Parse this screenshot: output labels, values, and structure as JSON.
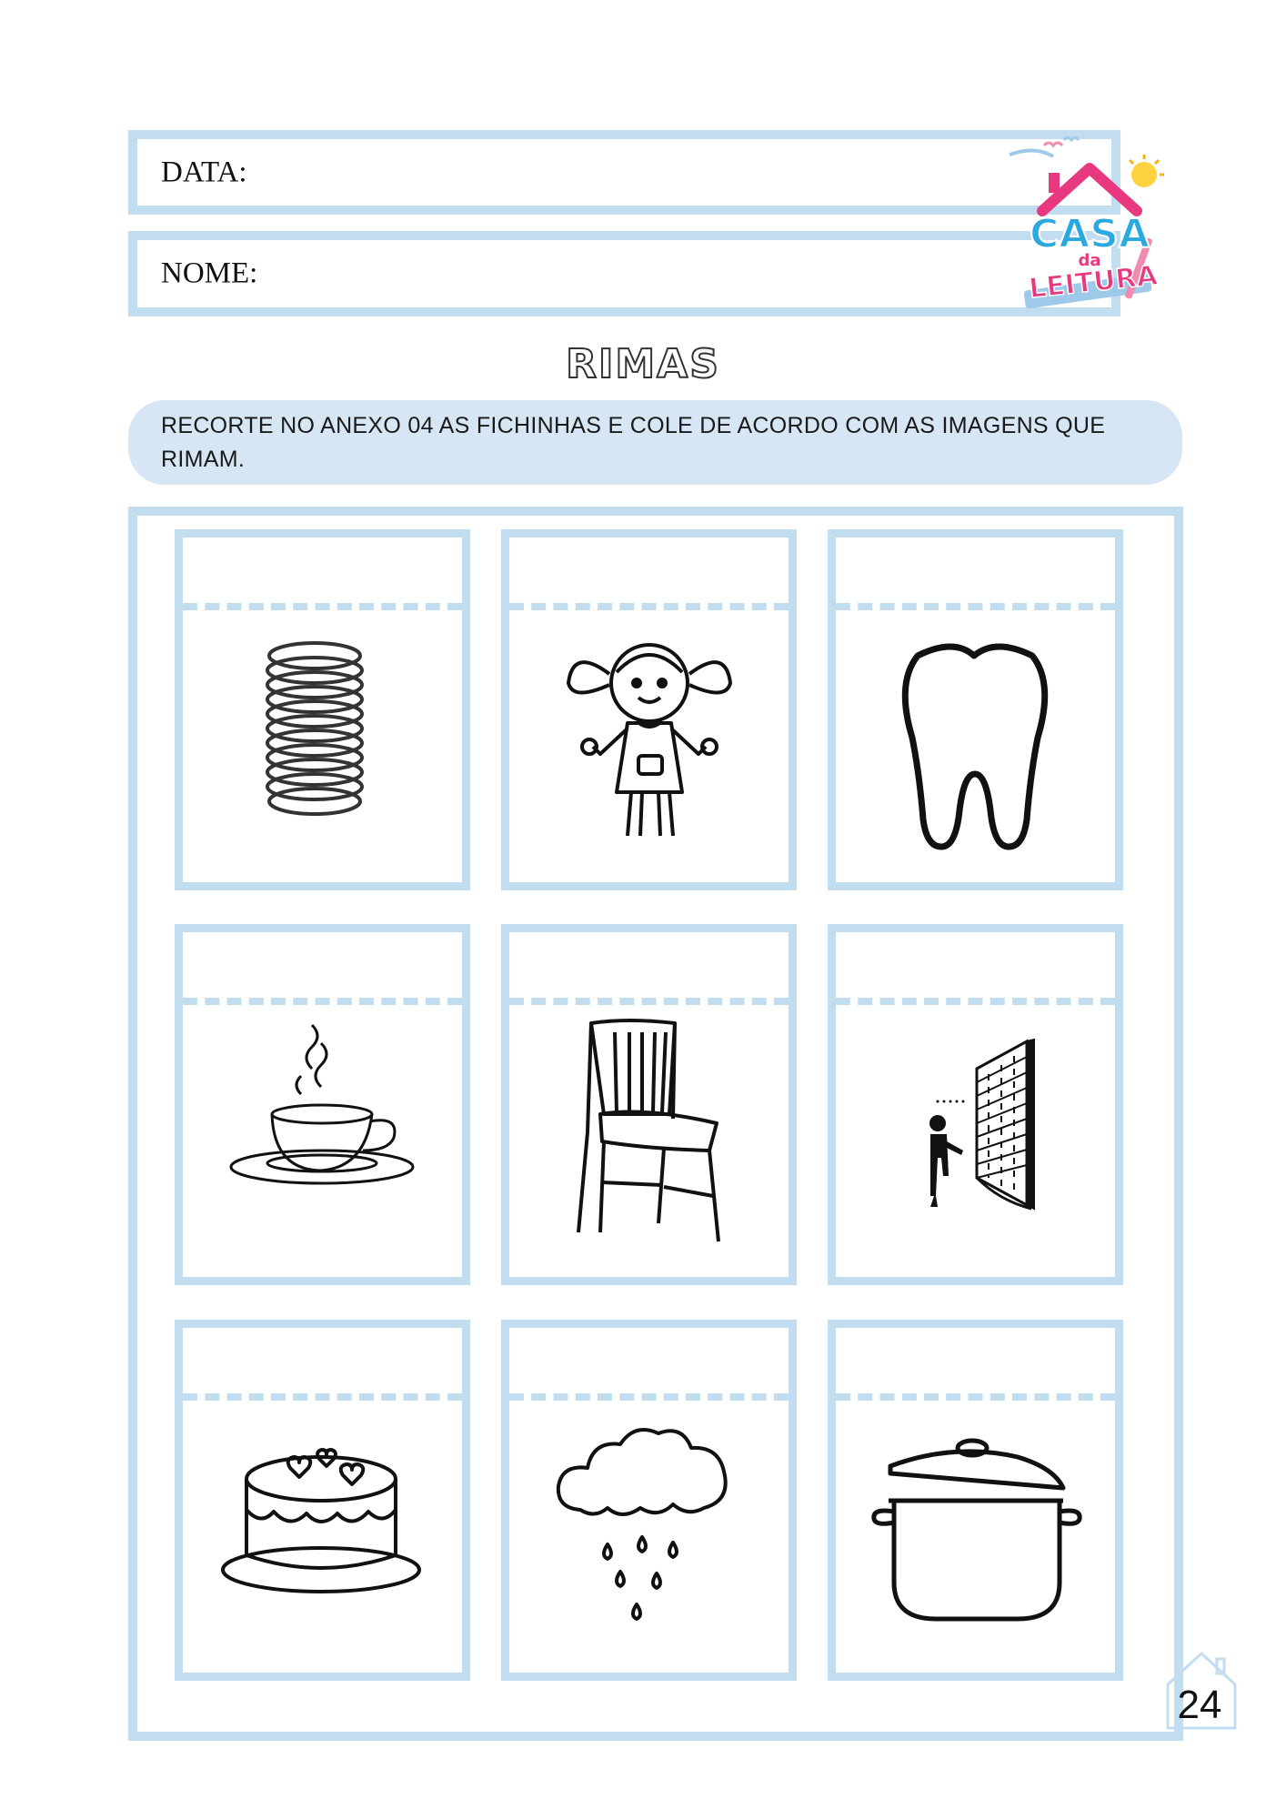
{
  "header": {
    "date_label": "DATA:",
    "name_label": "NOME:"
  },
  "logo": {
    "line1": "CASA",
    "line2": "da",
    "line3": "LEITURA"
  },
  "title": "RIMAS",
  "instruction": "RECORTE NO ANEXO 04 AS FICHINHAS E COLE DE ACORDO COM AS IMAGENS QUE RIMAM.",
  "cards": [
    {
      "icon": "spring-icon"
    },
    {
      "icon": "doll-icon"
    },
    {
      "icon": "tooth-icon"
    },
    {
      "icon": "teacup-icon"
    },
    {
      "icon": "chair-icon"
    },
    {
      "icon": "wall-icon"
    },
    {
      "icon": "cake-icon"
    },
    {
      "icon": "raincloud-icon"
    },
    {
      "icon": "pot-icon"
    }
  ],
  "page_number": "24",
  "colors": {
    "frame_blue": "#c2dcf0",
    "instruction_bg": "#d6e6f4",
    "logo_pink": "#e8387f",
    "logo_blue": "#2aa8e0"
  }
}
